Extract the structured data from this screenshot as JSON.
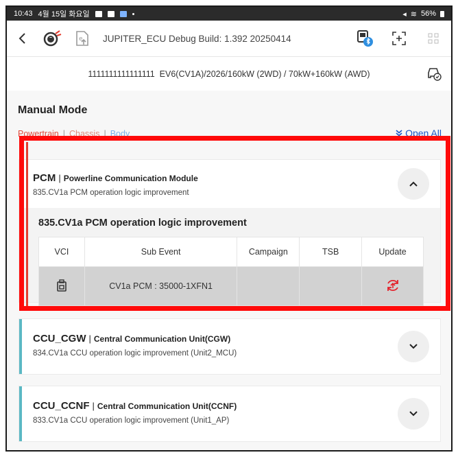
{
  "status_bar": {
    "time": "10:43",
    "date": "4월 15일 화요일",
    "battery": "56%"
  },
  "app_bar": {
    "title": "JUPITER_ECU Debug Build: 1.392 20250414",
    "icons": [
      "back-icon",
      "ecu-settings-icon",
      "ecu-update-icon",
      "vci-bluetooth-icon",
      "scan-icon",
      "grid-menu-icon"
    ]
  },
  "vehicle": {
    "info": "1111111111111111  EV6(CV1A)/2026/160kW (2WD) / 70kW+160kW (AWD)"
  },
  "manual_mode": {
    "title": "Manual Mode",
    "filters": [
      "Powertrain",
      "Chassis",
      "Body"
    ],
    "filter_separator": "|",
    "open_all": "Open All"
  },
  "modules": [
    {
      "code": "PCM",
      "name": "Powerline Communication Module",
      "subtitle": "835.CV1a PCM operation logic improvement",
      "expanded": true,
      "detail_title": "835.CV1a PCM operation logic improvement",
      "columns": [
        "VCI",
        "Sub Event",
        "Campaign",
        "TSB",
        "Update"
      ],
      "rows": [
        {
          "vci": "vci-device-icon",
          "sub_event": "CV1a PCM : 35000-1XFN1",
          "campaign": "",
          "tsb": "",
          "update": "update-icon"
        }
      ]
    },
    {
      "code": "CCU_CGW",
      "name": "Central Communication Unit(CGW)",
      "subtitle": "834.CV1a CCU operation logic improvement (Unit2_MCU)",
      "expanded": false
    },
    {
      "code": "CCU_CCNF",
      "name": "Central Communication Unit(CCNF)",
      "subtitle": "833.CV1a CCU operation logic improvement (Unit1_AP)",
      "expanded": false
    }
  ],
  "colors": {
    "powertrain": "#e04b3c",
    "chassis": "#e08a7a",
    "body": "#7ab0e8",
    "accent": "#5bb8c4",
    "highlight": "#ff0a0a",
    "update": "#e4202a",
    "link": "#1a56c8"
  }
}
